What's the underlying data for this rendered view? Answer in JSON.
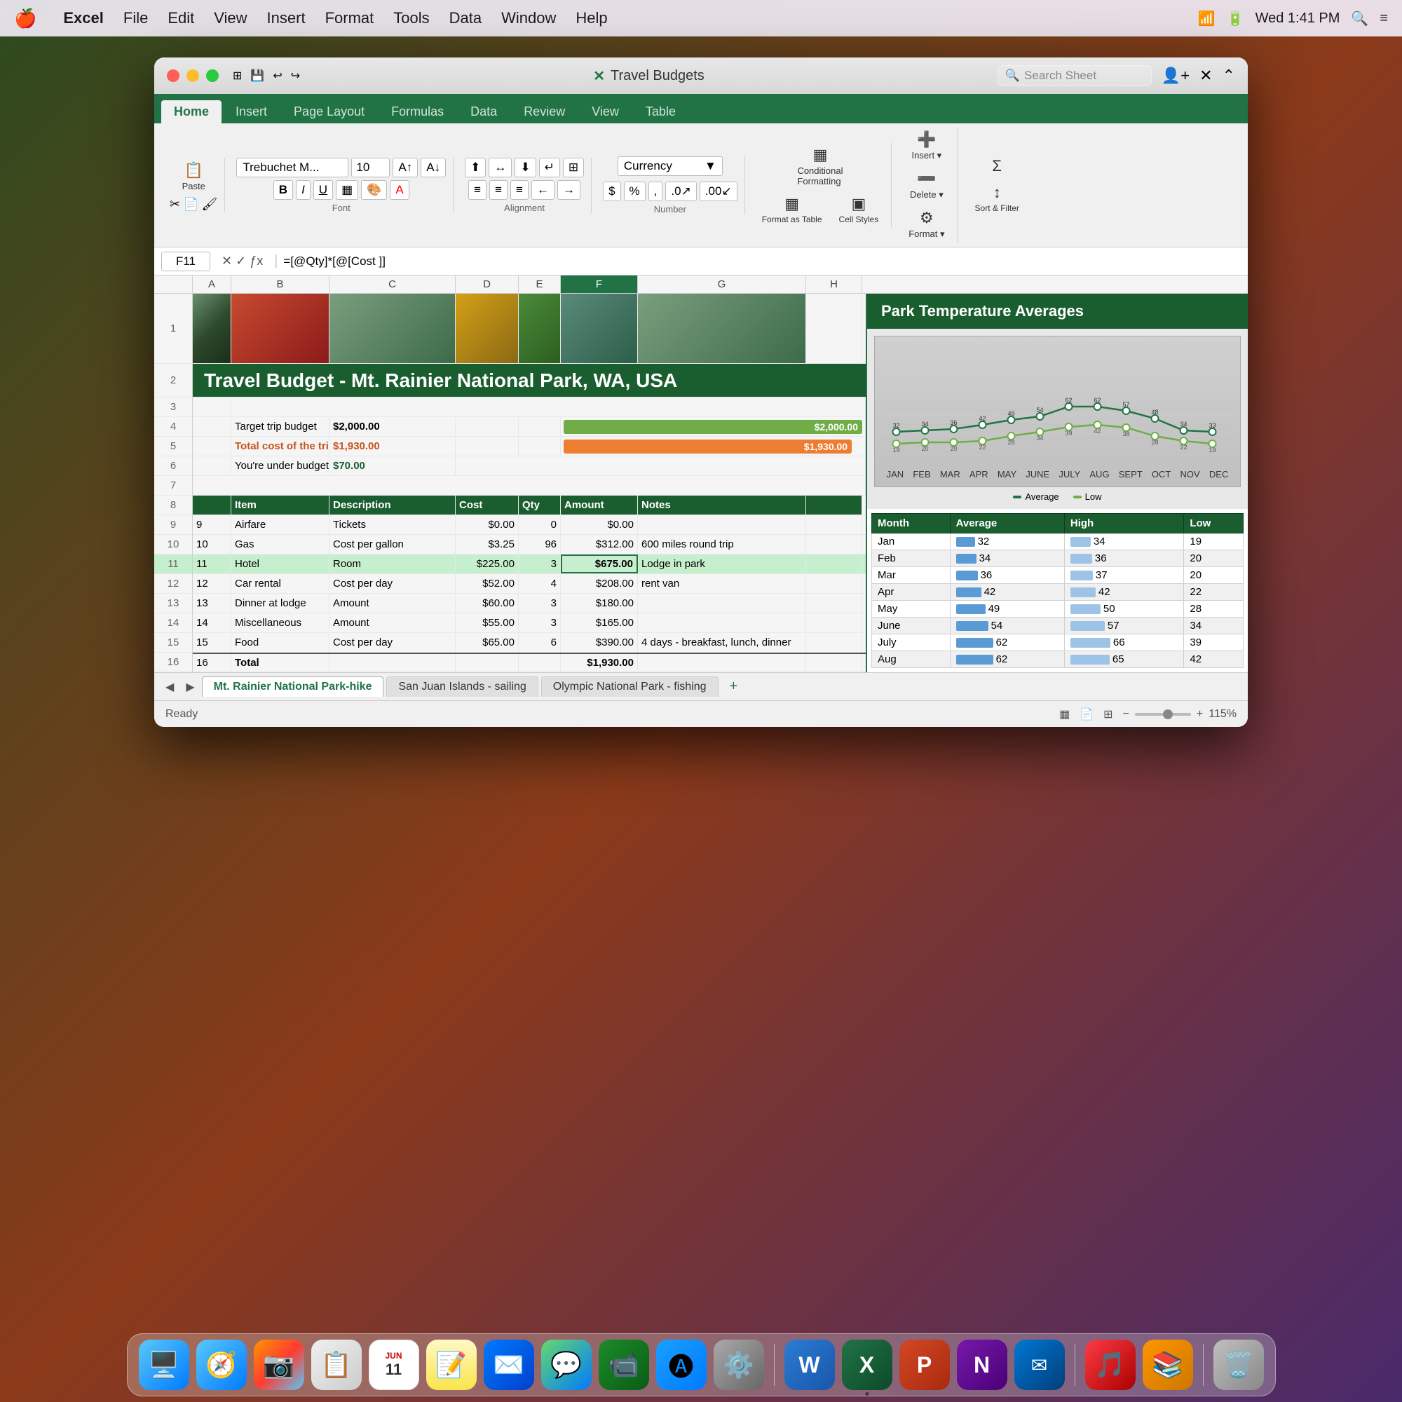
{
  "macMenuBar": {
    "appName": "Excel",
    "menus": [
      "File",
      "Edit",
      "View",
      "Insert",
      "Format",
      "Tools",
      "Data",
      "Window",
      "Help"
    ],
    "time": "Wed 1:41 PM"
  },
  "window": {
    "title": "Travel Budgets",
    "trafficLights": [
      "close",
      "minimize",
      "maximize"
    ]
  },
  "ribbon": {
    "tabs": [
      "Home",
      "Insert",
      "Page Layout",
      "Formulas",
      "Data",
      "Review",
      "View",
      "Table"
    ],
    "activeTab": "Home",
    "fontName": "Trebuchet M...",
    "fontSize": "10",
    "formatStyle": "Currency",
    "formulaBar": {
      "cellRef": "F11",
      "formula": "=[@Qty]*[@[Cost ]]"
    },
    "searchPlaceholder": "Search Sheet",
    "groups": {
      "clipboard": "Paste",
      "insert": "Insert ▾",
      "delete": "Delete ▾",
      "format": "Format ▾",
      "sort": "Sort & Filter",
      "formatAsTable": "Format as Table",
      "cellStyles": "Cell Styles",
      "conditionalFormatting": "Conditional Formatting",
      "formatAsTableLabel": "Format as Table",
      "cellStylesLabel": "Cell Styles"
    }
  },
  "spreadsheet": {
    "colHeaders": [
      "A",
      "B",
      "C",
      "D",
      "E",
      "F",
      "G",
      "H"
    ],
    "titleText": "Travel Budget - Mt. Rainier National Park, WA, USA",
    "budgetLabel": "Target trip budget",
    "budgetValue": "$2,000.00",
    "budgetProgress": "$2,000.00",
    "totalLabel": "Total cost of the trip",
    "totalValue": "$1,930.00",
    "totalProgress": "$1,930.00",
    "underBudgetLabel": "You're under budget by",
    "underBudgetValue": "$70.00",
    "tableHeaders": [
      "Item",
      "Description",
      "Cost",
      "Qty",
      "Amount",
      "Notes"
    ],
    "rows": [
      {
        "num": 9,
        "item": "Airfare",
        "desc": "Tickets",
        "cost": "$0.00",
        "qty": "0",
        "amount": "$0.00",
        "notes": ""
      },
      {
        "num": 10,
        "item": "Gas",
        "desc": "Cost per gallon",
        "cost": "$3.25",
        "qty": "96",
        "amount": "$312.00",
        "notes": "600 miles round trip"
      },
      {
        "num": 11,
        "item": "Hotel",
        "desc": "Room",
        "cost": "$225.00",
        "qty": "3",
        "amount": "$675.00",
        "notes": "Lodge in park",
        "selected": true
      },
      {
        "num": 12,
        "item": "Car rental",
        "desc": "Cost per day",
        "cost": "$52.00",
        "qty": "4",
        "amount": "$208.00",
        "notes": "rent van"
      },
      {
        "num": 13,
        "item": "Dinner at lodge",
        "desc": "Amount",
        "cost": "$60.00",
        "qty": "3",
        "amount": "$180.00",
        "notes": ""
      },
      {
        "num": 14,
        "item": "Miscellaneous",
        "desc": "Amount",
        "cost": "$55.00",
        "qty": "3",
        "amount": "$165.00",
        "notes": ""
      },
      {
        "num": 15,
        "item": "Food",
        "desc": "Cost per day",
        "cost": "$65.00",
        "qty": "6",
        "amount": "$390.00",
        "notes": "4 days - breakfast, lunch, dinner"
      },
      {
        "num": 16,
        "item": "Total",
        "desc": "",
        "cost": "",
        "qty": "",
        "amount": "$1,930.00",
        "notes": "",
        "total": true
      }
    ]
  },
  "temperatureChart": {
    "title": "Park Temperature Averages",
    "months": [
      "JAN",
      "FEB",
      "MAR",
      "APR",
      "MAY",
      "JUNE",
      "JULY",
      "AUG",
      "SEPT",
      "OCT",
      "NOV",
      "DEC"
    ],
    "avgValues": [
      32,
      34,
      36,
      42,
      49,
      54,
      62,
      62,
      57,
      48,
      34,
      33
    ],
    "lowValues": [
      19,
      20,
      20,
      22,
      28,
      34,
      39,
      42,
      38,
      28,
      22,
      19
    ],
    "legend": {
      "avg": "Average",
      "low": "Low"
    },
    "tableHeaders": [
      "Month",
      "Average",
      "High",
      "Low"
    ],
    "tableRows": [
      {
        "month": "Jan",
        "avg": 32,
        "high": 34,
        "low": 19
      },
      {
        "month": "Feb",
        "avg": 34,
        "high": 36,
        "low": 20
      },
      {
        "month": "Mar",
        "avg": 36,
        "high": 37,
        "low": 20
      },
      {
        "month": "Apr",
        "avg": 42,
        "high": 42,
        "low": 22
      },
      {
        "month": "May",
        "avg": 49,
        "high": 50,
        "low": 28
      },
      {
        "month": "June",
        "avg": 54,
        "high": 57,
        "low": 34
      },
      {
        "month": "July",
        "avg": 62,
        "high": 66,
        "low": 39
      },
      {
        "month": "Aug",
        "avg": 62,
        "high": 65,
        "low": 42
      }
    ]
  },
  "sheetTabs": [
    {
      "label": "Mt. Rainier National Park-hike",
      "active": true
    },
    {
      "label": "San Juan Islands - sailing",
      "active": false
    },
    {
      "label": "Olympic National Park - fishing",
      "active": false
    }
  ],
  "statusBar": {
    "ready": "Ready",
    "zoom": "115%"
  },
  "dock": {
    "icons": [
      {
        "name": "finder",
        "emoji": "🖥️"
      },
      {
        "name": "safari",
        "emoji": "🧭"
      },
      {
        "name": "photos",
        "emoji": "📷"
      },
      {
        "name": "contacts",
        "emoji": "📋"
      },
      {
        "name": "calendar",
        "emoji": "📅"
      },
      {
        "name": "notes",
        "emoji": "📝"
      },
      {
        "name": "messages",
        "emoji": "💬"
      },
      {
        "name": "facetime",
        "emoji": "📹"
      },
      {
        "name": "appstore",
        "emoji": "🔵"
      },
      {
        "name": "activity",
        "emoji": "📊"
      },
      {
        "name": "word",
        "emoji": "W"
      },
      {
        "name": "excel",
        "emoji": "X"
      },
      {
        "name": "powerpoint",
        "emoji": "P"
      },
      {
        "name": "onenote",
        "emoji": "N"
      },
      {
        "name": "outlook",
        "emoji": "✉"
      },
      {
        "name": "music",
        "emoji": "🎵"
      },
      {
        "name": "books",
        "emoji": "📚"
      },
      {
        "name": "trash",
        "emoji": "🗑️"
      }
    ]
  }
}
